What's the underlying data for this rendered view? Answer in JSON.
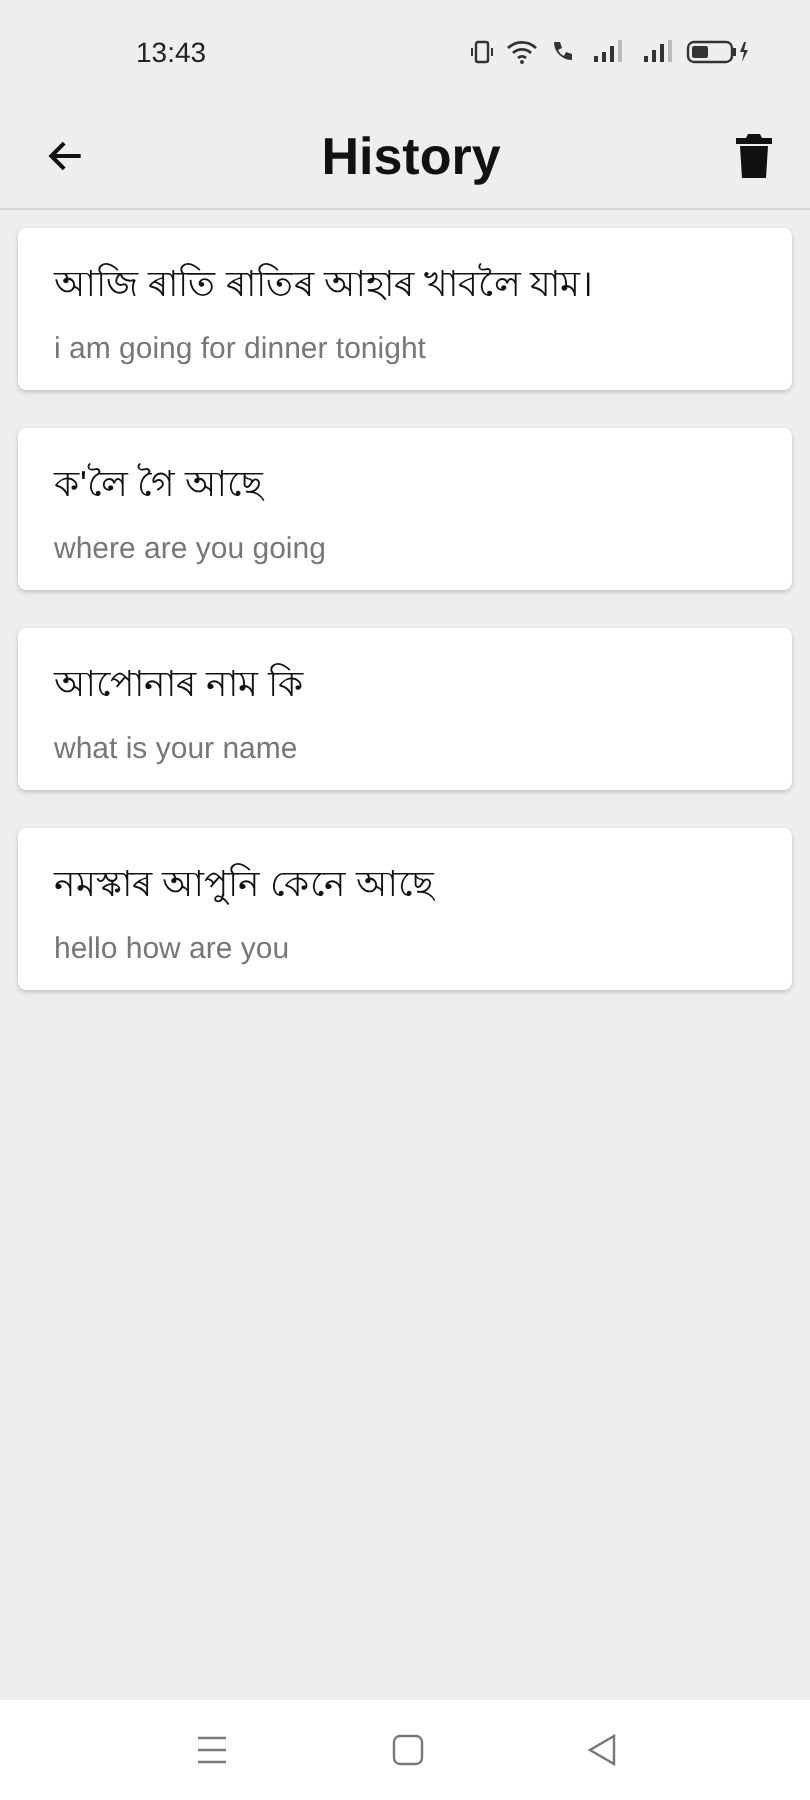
{
  "status_bar": {
    "time": "13:43"
  },
  "header": {
    "title": "History"
  },
  "history": [
    {
      "source": "আজি ৰাতি ৰাতিৰ আহাৰ খাবলৈ যাম।",
      "translation": "i am going for dinner tonight"
    },
    {
      "source": "ক'লৈ গৈ আছে",
      "translation": "where are you going"
    },
    {
      "source": "আপোনাৰ নাম কি",
      "translation": "what is your name"
    },
    {
      "source": "নমস্কাৰ আপুনি কেনে আছে",
      "translation": "hello how are you"
    }
  ]
}
